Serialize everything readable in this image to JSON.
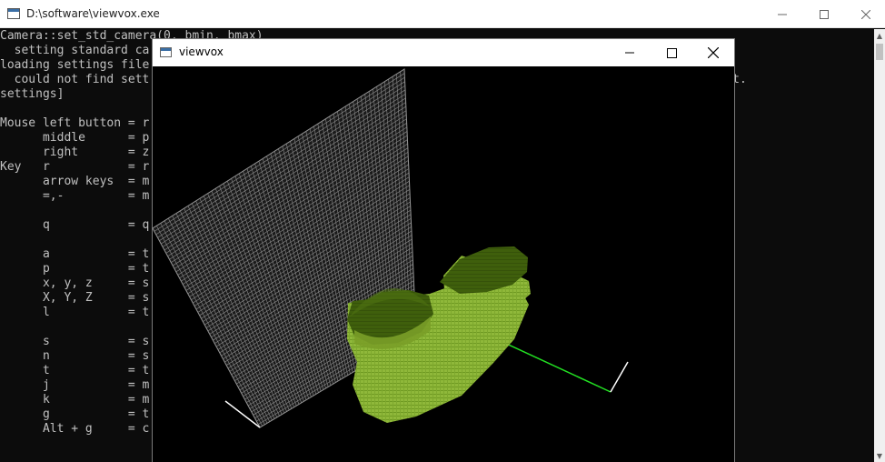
{
  "console": {
    "title": "D:\\software\\viewvox.exe",
    "lines": [
      "Camera::set_std_camera(0, bmin, bmax)",
      "  setting standard ca",
      "loading settings file",
      "  could not find sett                                                                 ple\\rebuild\\result.",
      "settings]",
      "",
      "Mouse left button = r",
      "      middle      = p",
      "      right       = z",
      "Key   r           = r",
      "      arrow keys  = m",
      "      =,-         = m",
      "",
      "      q           = q",
      "",
      "      a           = t",
      "      p           = t",
      "      x, y, z     = s",
      "      X, Y, Z     = s",
      "      l           = t",
      "",
      "      s           = s",
      "      n           = s",
      "      t           = t",
      "      j           = m",
      "      k           = m",
      "      g           = t",
      "      Alt + g     = c"
    ]
  },
  "viewer": {
    "title": "viewvox"
  },
  "colors": {
    "console_bg": "#0c0c0c",
    "console_text": "#c0c0c0",
    "voxel_light": "#8fb83a",
    "voxel_dark": "#3f5f0c",
    "grid": "#9a9a9a",
    "axis_green": "#22e022",
    "axis_white": "#ffffff"
  },
  "icons": {
    "minimize": "minimize-icon",
    "maximize": "maximize-icon",
    "close": "close-icon"
  }
}
